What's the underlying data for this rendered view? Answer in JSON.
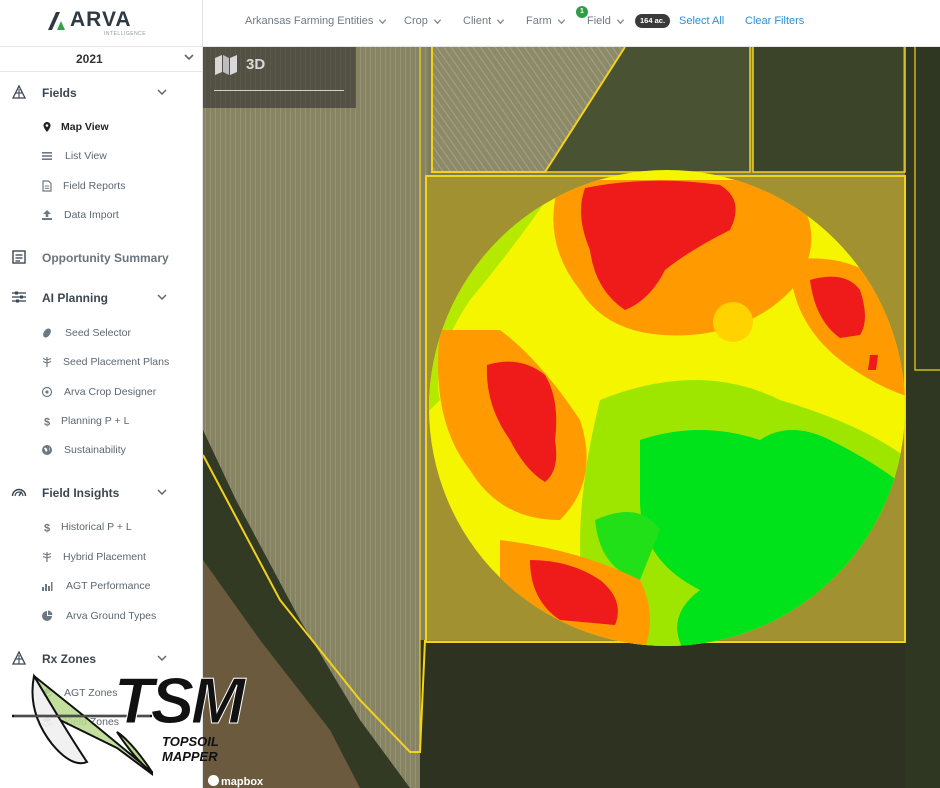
{
  "brand": {
    "name": "ARVA",
    "tagline": "INTELLIGENCE"
  },
  "year_selector": {
    "value": "2021"
  },
  "sidebar": {
    "sections": [
      {
        "label": "Fields",
        "icon": "field-icon",
        "items": [
          {
            "label": "Map View",
            "icon": "map-pin-icon",
            "active": true
          },
          {
            "label": "List View",
            "icon": "list-icon"
          },
          {
            "label": "Field Reports",
            "icon": "report-icon"
          },
          {
            "label": "Data Import",
            "icon": "upload-icon"
          }
        ]
      },
      {
        "label": "Opportunity Summary",
        "icon": "summary-icon",
        "items": []
      },
      {
        "label": "AI Planning",
        "icon": "sliders-icon",
        "items": [
          {
            "label": "Seed Selector",
            "icon": "seed-icon"
          },
          {
            "label": "Seed Placement Plans",
            "icon": "plant-icon"
          },
          {
            "label": "Arva Crop Designer",
            "icon": "target-icon"
          },
          {
            "label": "Planning P + L",
            "icon": "dollar-icon"
          },
          {
            "label": "Sustainability",
            "icon": "globe-icon"
          }
        ]
      },
      {
        "label": "Field Insights",
        "icon": "gauge-icon",
        "items": [
          {
            "label": "Historical P + L",
            "icon": "dollar-icon"
          },
          {
            "label": "Hybrid Placement",
            "icon": "plant-icon"
          },
          {
            "label": "AGT Performance",
            "icon": "bar-chart-icon"
          },
          {
            "label": "Arva Ground Types",
            "icon": "pie-icon"
          }
        ]
      },
      {
        "label": "Rx Zones",
        "icon": "field-icon",
        "items": [
          {
            "label": "AGT Zones",
            "icon": "layers-icon"
          },
          {
            "label": "Yield Zones",
            "icon": "layers-icon"
          }
        ]
      }
    ]
  },
  "filters": {
    "items": [
      {
        "label": "Arkansas Farming Entities"
      },
      {
        "label": "Crop"
      },
      {
        "label": "Client"
      },
      {
        "label": "Farm"
      },
      {
        "label": "Field"
      }
    ],
    "field_selected_count": "1",
    "acres_badge": "164 ac.",
    "select_all": "Select All",
    "clear_filters": "Clear Filters"
  },
  "map": {
    "view_toggle": "3D",
    "attribution": "mapbox",
    "boundary_color": "#f2d21b",
    "zone_colors": {
      "high": "#00e21a",
      "mid_high": "#9ee600",
      "mid": "#f5f500",
      "mid_low": "#ff9b00",
      "low": "#ef1a1a"
    }
  },
  "watermark": {
    "title": "TSM",
    "subtitle": "TOPSOIL MAPPER"
  }
}
